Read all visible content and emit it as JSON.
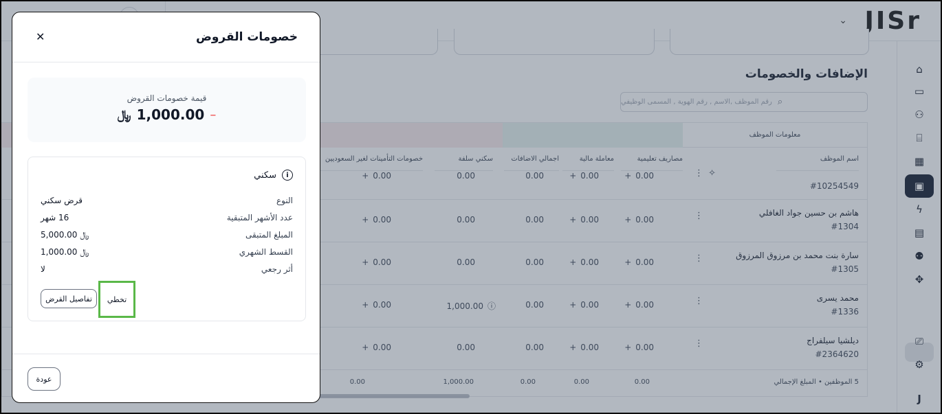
{
  "app": {
    "logo": "JISr",
    "section_title": "الإضافات والخصومات",
    "search_placeholder": "رقم الموظف ,الاسم , رقم الهوية , المسمى الوظيفي"
  },
  "sidebar": {
    "icons": [
      "home-icon",
      "inbox-icon",
      "users-icon",
      "bank-icon",
      "calendar-icon",
      "payroll-icon",
      "automation-icon",
      "report-icon",
      "user-settings-icon",
      "integrations-icon",
      "gift-icon",
      "settings-icon",
      "user-initial-icon"
    ],
    "user_initial": "J"
  },
  "table": {
    "group_header": "معلومات الموظف",
    "columns": [
      "اسم الموظف",
      "مصاريف تعليمية",
      "معاملة مالية",
      "اجمالي الاضافات",
      "سكني سلفة",
      "خصومات التأمينات لغير السعوديين"
    ],
    "rows": [
      {
        "name": "",
        "id": "#10254549",
        "edu": "0.00",
        "fin": "0.00",
        "total": "0.00",
        "housing": "0.00",
        "gosi": "0.00"
      },
      {
        "name": "هاشم بن حسين جواد الغافلي",
        "id": "#1304",
        "edu": "0.00",
        "fin": "0.00",
        "total": "0.00",
        "housing": "0.00",
        "gosi": "0.00"
      },
      {
        "name": "سارة بنت محمد بن مرزوق المرزوق",
        "id": "#1305",
        "edu": "0.00",
        "fin": "0.00",
        "total": "0.00",
        "housing": "0.00",
        "gosi": "0.00"
      },
      {
        "name": "محمد يسرى",
        "id": "#1336",
        "edu": "0.00",
        "fin": "0.00",
        "total": "0.00",
        "housing": "1,000.00",
        "gosi": "0.00"
      },
      {
        "name": "ديلشيا سيلفراج",
        "id": "#2364620",
        "edu": "0.00",
        "fin": "0.00",
        "total": "0.00",
        "housing": "0.00",
        "gosi": "0.00"
      }
    ],
    "footer": {
      "label": "5 الموظفين • المبلغ الإجمالي",
      "edu": "0.00",
      "fin": "0.00",
      "total": "0.00",
      "housing": "1,000.00",
      "gosi": "0.00"
    }
  },
  "modal": {
    "title": "خصومات القروض",
    "summary_label": "قيمة خصومات القروض",
    "summary_sign": "–",
    "summary_amount": "1,000.00",
    "currency_symbol": "﷼",
    "loan": {
      "title": "سكني",
      "fields": [
        {
          "key": "النوع",
          "value": "قرض سكني"
        },
        {
          "key": "عدد الأشهر المتبقية",
          "value": "16 شهر"
        },
        {
          "key": "المبلغ المتبقى",
          "value": "5,000.00"
        },
        {
          "key": "القسط الشهري",
          "value": "1,000.00"
        },
        {
          "key": "أثر رجعي",
          "value": "لا"
        }
      ],
      "details_button": "تفاصيل القرض",
      "skip_button": "تخطي"
    },
    "back_button": "عودة",
    "accent_colors": {
      "highlight": "#5ab848",
      "minus": "#ef4444"
    }
  }
}
